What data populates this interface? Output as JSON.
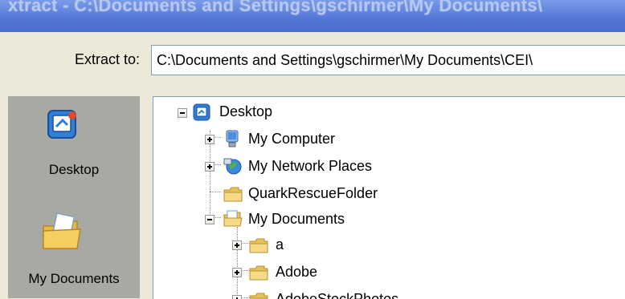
{
  "window": {
    "title": "xtract - C:\\Documents and Settings\\gschirmer\\My Documents\\"
  },
  "extract": {
    "label": "Extract to:",
    "value": "C:\\Documents and Settings\\gschirmer\\My Documents\\CEI\\"
  },
  "places_bar": {
    "items": [
      {
        "label": "Desktop",
        "icon": "desktop-icon"
      },
      {
        "label": "My Documents",
        "icon": "my-documents-icon"
      }
    ]
  },
  "tree": {
    "items": [
      {
        "label": "Desktop",
        "icon": "desktop-icon",
        "expander": "minus"
      },
      {
        "label": "My Computer",
        "icon": "computer-icon",
        "expander": "plus"
      },
      {
        "label": "My Network Places",
        "icon": "network-icon",
        "expander": "plus"
      },
      {
        "label": "QuarkRescueFolder",
        "icon": "folder-icon",
        "expander": "none"
      },
      {
        "label": "My Documents",
        "icon": "my-documents-icon",
        "expander": "minus"
      },
      {
        "label": "a",
        "icon": "folder-icon",
        "expander": "plus"
      },
      {
        "label": "Adobe",
        "icon": "folder-icon",
        "expander": "plus"
      },
      {
        "label": "AdobeStockPhotos",
        "icon": "folder-icon",
        "expander": "plus"
      }
    ]
  },
  "colors": {
    "titlebar": "#5276d6",
    "dialog_bg": "#ece9d8",
    "places_bg": "#a9a9a3",
    "folder": "#f2d27a"
  }
}
